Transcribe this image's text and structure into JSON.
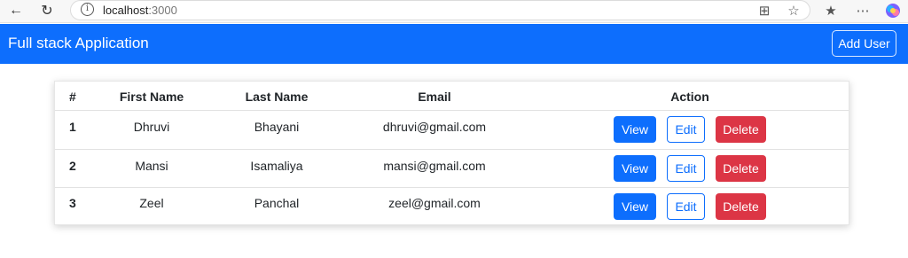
{
  "browser": {
    "url_host": "localhost",
    "url_port": ":3000"
  },
  "navbar": {
    "brand": "Full stack Application",
    "add_user_label": "Add User"
  },
  "table": {
    "headers": [
      "#",
      "First Name",
      "Last Name",
      "Email",
      "Action"
    ],
    "rows": [
      {
        "id": "1",
        "first": "Dhruvi",
        "last": "Bhayani",
        "email": "dhruvi@gmail.com"
      },
      {
        "id": "2",
        "first": "Mansi",
        "last": "Isamaliya",
        "email": "mansi@gmail.com"
      },
      {
        "id": "3",
        "first": "Zeel",
        "last": "Panchal",
        "email": "zeel@gmail.com"
      }
    ],
    "actions": {
      "view": "View",
      "edit": "Edit",
      "delete": "Delete"
    }
  },
  "colors": {
    "primary": "#0d6efd",
    "danger": "#dc3545"
  }
}
